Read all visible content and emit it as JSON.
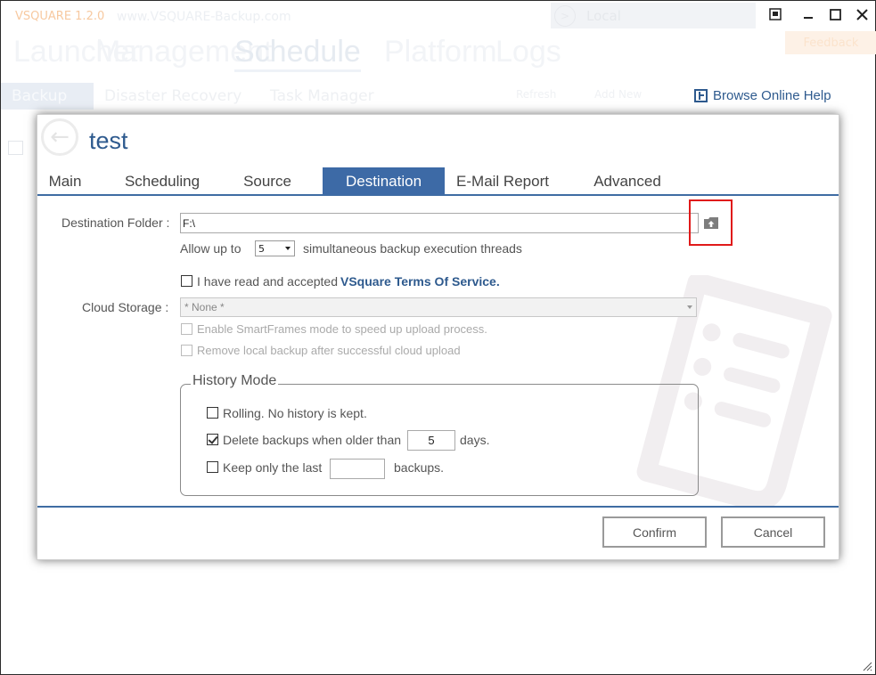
{
  "app": {
    "title": "VSQUARE 1.2.0",
    "subtitle": "www.VSQUARE-Backup.com",
    "local_label": "Local",
    "feedback_label": "Feedback",
    "nav_big": [
      "Launcher",
      "Management",
      "Schedule",
      "Platform",
      "Logs"
    ],
    "tabs": [
      "Backup",
      "Disaster Recovery",
      "Task Manager"
    ],
    "toolbar": {
      "refresh": "Refresh",
      "add_new": "Add New"
    },
    "browse_help": "Browse Online Help"
  },
  "dialog": {
    "title": "test",
    "tabs": [
      {
        "label": "Main"
      },
      {
        "label": "Scheduling"
      },
      {
        "label": "Source"
      },
      {
        "label": "Destination",
        "active": true
      },
      {
        "label": "E-Mail Report"
      },
      {
        "label": "Advanced"
      }
    ],
    "destination": {
      "folder_label": "Destination Folder :",
      "folder_value": "F:\\",
      "allow_up_to": "Allow up to",
      "threads_value": "5",
      "threads_suffix": "simultaneous backup execution threads"
    },
    "terms": {
      "checkbox_label": "I have read and accepted",
      "link": "VSquare Terms Of Service.",
      "checked": false
    },
    "cloud": {
      "label": "Cloud Storage :",
      "selected": "* None *",
      "smartframes": "Enable SmartFrames mode to speed up upload process.",
      "remove_local": "Remove local backup after successful cloud upload"
    },
    "history": {
      "title": "History Mode",
      "rolling": "Rolling. No history is kept.",
      "delete_older": "Delete backups when older than",
      "delete_older_value": "5",
      "delete_older_suffix": "days.",
      "delete_older_checked": true,
      "keep_last": "Keep only the last",
      "keep_last_value": "",
      "keep_last_suffix": "backups."
    },
    "buttons": {
      "confirm": "Confirm",
      "cancel": "Cancel"
    }
  },
  "colors": {
    "accent": "#3d6aa6",
    "link": "#2e5a8e",
    "highlight": "#e01a1a"
  }
}
